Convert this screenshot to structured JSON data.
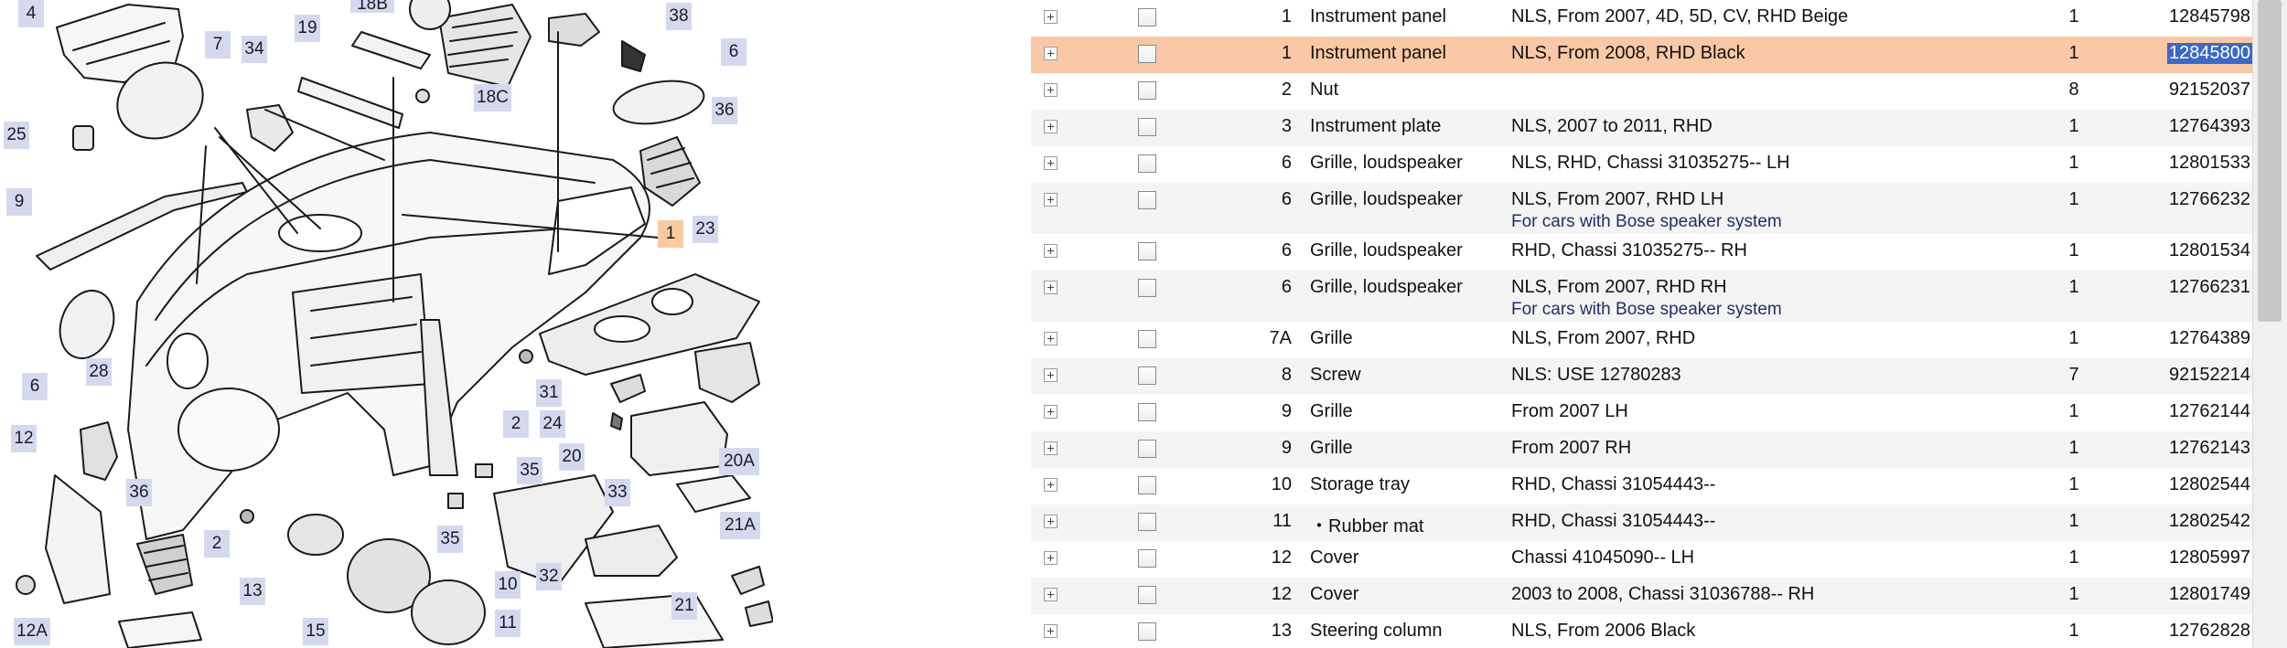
{
  "diagram": {
    "callouts": [
      {
        "label": "4",
        "active": false
      },
      {
        "label": "18B",
        "active": false
      },
      {
        "label": "38",
        "active": false
      },
      {
        "label": "19",
        "active": false
      },
      {
        "label": "7",
        "active": false
      },
      {
        "label": "34",
        "active": false
      },
      {
        "label": "6",
        "active": false
      },
      {
        "label": "18C",
        "active": false
      },
      {
        "label": "36",
        "active": false
      },
      {
        "label": "25",
        "active": false
      },
      {
        "label": "9",
        "active": false
      },
      {
        "label": "1",
        "active": true
      },
      {
        "label": "23",
        "active": false
      },
      {
        "label": "6",
        "active": false
      },
      {
        "label": "28",
        "active": false
      },
      {
        "label": "31",
        "active": false
      },
      {
        "label": "2",
        "active": false
      },
      {
        "label": "24",
        "active": false
      },
      {
        "label": "20",
        "active": false
      },
      {
        "label": "20A",
        "active": false
      },
      {
        "label": "12",
        "active": false
      },
      {
        "label": "35",
        "active": false
      },
      {
        "label": "36",
        "active": false
      },
      {
        "label": "33",
        "active": false
      },
      {
        "label": "2",
        "active": false
      },
      {
        "label": "35",
        "active": false
      },
      {
        "label": "21A",
        "active": false
      },
      {
        "label": "13",
        "active": false
      },
      {
        "label": "10",
        "active": false
      },
      {
        "label": "32",
        "active": false
      },
      {
        "label": "12A",
        "active": false
      },
      {
        "label": "15",
        "active": false
      },
      {
        "label": "11",
        "active": false
      },
      {
        "label": "21",
        "active": false
      }
    ]
  },
  "parts": {
    "rows": [
      {
        "pos": "1",
        "name": "Instrument panel",
        "desc": "NLS, From 2007, 4D, 5D, CV, RHD Beige",
        "note": "",
        "qty": "1",
        "part_no": "12845798",
        "selected": false
      },
      {
        "pos": "1",
        "name": "Instrument panel",
        "desc": "NLS, From 2008, RHD Black",
        "note": "",
        "qty": "1",
        "part_no": "12845800",
        "selected": true
      },
      {
        "pos": "2",
        "name": "Nut",
        "desc": "",
        "note": "",
        "qty": "8",
        "part_no": "92152037",
        "selected": false
      },
      {
        "pos": "3",
        "name": "Instrument plate",
        "desc": "NLS, 2007 to 2011, RHD",
        "note": "",
        "qty": "1",
        "part_no": "12764393",
        "selected": false
      },
      {
        "pos": "6",
        "name": "Grille, loudspeaker",
        "desc": "NLS, RHD, Chassi 31035275-- LH",
        "note": "",
        "qty": "1",
        "part_no": "12801533",
        "selected": false
      },
      {
        "pos": "6",
        "name": "Grille, loudspeaker",
        "desc": "NLS, From 2007, RHD LH",
        "note": "For cars with Bose speaker system",
        "qty": "1",
        "part_no": "12766232",
        "selected": false
      },
      {
        "pos": "6",
        "name": "Grille, loudspeaker",
        "desc": "RHD, Chassi 31035275-- RH",
        "note": "",
        "qty": "1",
        "part_no": "12801534",
        "selected": false
      },
      {
        "pos": "6",
        "name": "Grille, loudspeaker",
        "desc": "NLS, From 2007, RHD RH",
        "note": "For cars with Bose speaker system",
        "qty": "1",
        "part_no": "12766231",
        "selected": false
      },
      {
        "pos": "7A",
        "name": "Grille",
        "desc": "NLS, From 2007, RHD",
        "note": "",
        "qty": "1",
        "part_no": "12764389",
        "selected": false
      },
      {
        "pos": "8",
        "name": "Screw",
        "desc": "NLS: USE 12780283",
        "note": "",
        "qty": "7",
        "part_no": "92152214",
        "selected": false
      },
      {
        "pos": "9",
        "name": "Grille",
        "desc": "From 2007 LH",
        "note": "",
        "qty": "1",
        "part_no": "12762144",
        "selected": false
      },
      {
        "pos": "9",
        "name": "Grille",
        "desc": "From 2007 RH",
        "note": "",
        "qty": "1",
        "part_no": "12762143",
        "selected": false
      },
      {
        "pos": "10",
        "name": "Storage tray",
        "desc": "RHD, Chassi 31054443--",
        "note": "",
        "qty": "1",
        "part_no": "12802544",
        "selected": false
      },
      {
        "pos": "11",
        "name": "・Rubber mat",
        "desc": "RHD, Chassi 31054443--",
        "note": "",
        "qty": "1",
        "part_no": "12802542",
        "selected": false
      },
      {
        "pos": "12",
        "name": "Cover",
        "desc": "Chassi 41045090-- LH",
        "note": "",
        "qty": "1",
        "part_no": "12805997",
        "selected": false
      },
      {
        "pos": "12",
        "name": "Cover",
        "desc": "2003 to 2008, Chassi 31036788-- RH",
        "note": "",
        "qty": "1",
        "part_no": "12801749",
        "selected": false
      },
      {
        "pos": "13",
        "name": "Steering column",
        "desc": "NLS, From 2006 Black",
        "note": "",
        "qty": "1",
        "part_no": "12762828",
        "selected": false
      }
    ]
  }
}
